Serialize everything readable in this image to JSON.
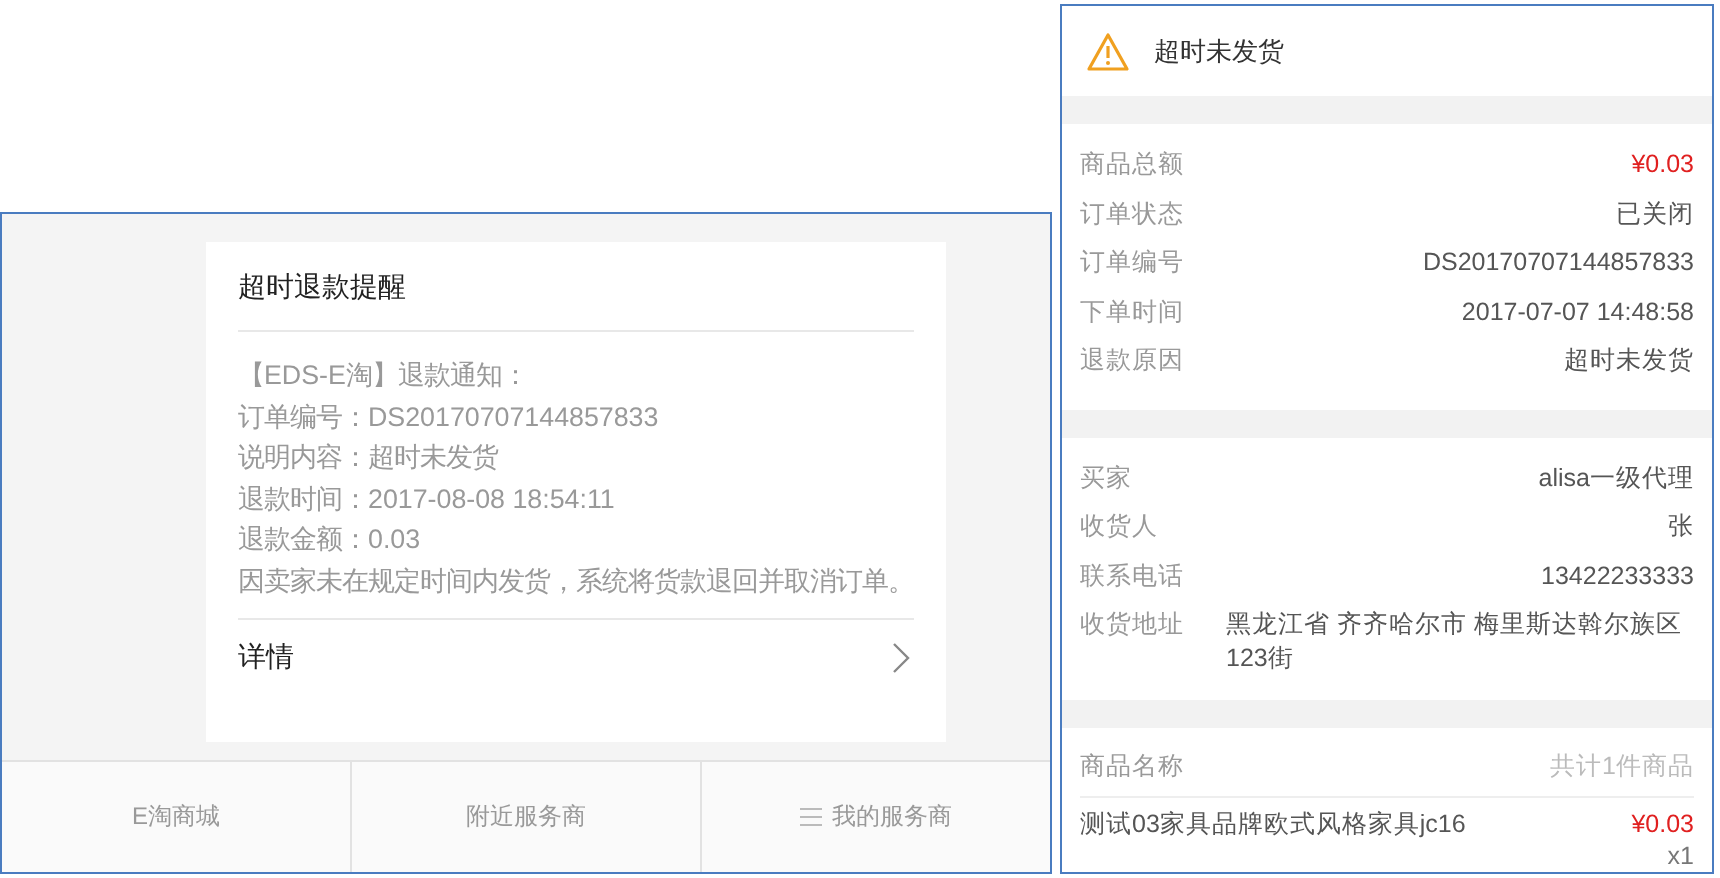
{
  "refund_notice": {
    "title": "超时退款提醒",
    "lines": [
      "【EDS-E淘】退款通知：",
      "订单编号：DS20170707144857833",
      "说明内容：超时未发货",
      "退款时间：2017-08-08 18:54:11",
      "退款金额：0.03",
      "因卖家未在规定时间内发货，系统将货款退回并取消订单。"
    ],
    "details_link": "详情"
  },
  "bottom_nav": [
    {
      "label": "E淘商城",
      "menu_icon": false
    },
    {
      "label": "附近服务商",
      "menu_icon": false
    },
    {
      "label": "我的服务商",
      "menu_icon": true
    }
  ],
  "order_detail": {
    "status_title": "超时未发货",
    "sections": [
      {
        "rows": [
          {
            "label": "商品总额",
            "value": "¥0.03",
            "kind": "price"
          },
          {
            "label": "订单状态",
            "value": "已关闭",
            "kind": "text"
          },
          {
            "label": "订单编号",
            "value": "DS20170707144857833",
            "kind": "text"
          },
          {
            "label": "下单时间",
            "value": "2017-07-07 14:48:58",
            "kind": "text"
          },
          {
            "label": "退款原因",
            "value": "超时未发货",
            "kind": "text"
          }
        ]
      },
      {
        "rows": [
          {
            "label": "买家",
            "value": "alisa一级代理",
            "kind": "text"
          },
          {
            "label": "收货人",
            "value": "张",
            "kind": "text"
          },
          {
            "label": "联系电话",
            "value": "13422233333",
            "kind": "text"
          },
          {
            "label": "收货地址",
            "value": "黑龙江省 齐齐哈尔市 梅里斯达斡尔族区123街",
            "kind": "address"
          }
        ]
      }
    ],
    "products_header": {
      "label": "商品名称",
      "count": "共计1件商品"
    },
    "products": [
      {
        "name": "测试03家具品牌欧式风格家具jc16",
        "price": "¥0.03",
        "quantity": "x1"
      }
    ]
  }
}
